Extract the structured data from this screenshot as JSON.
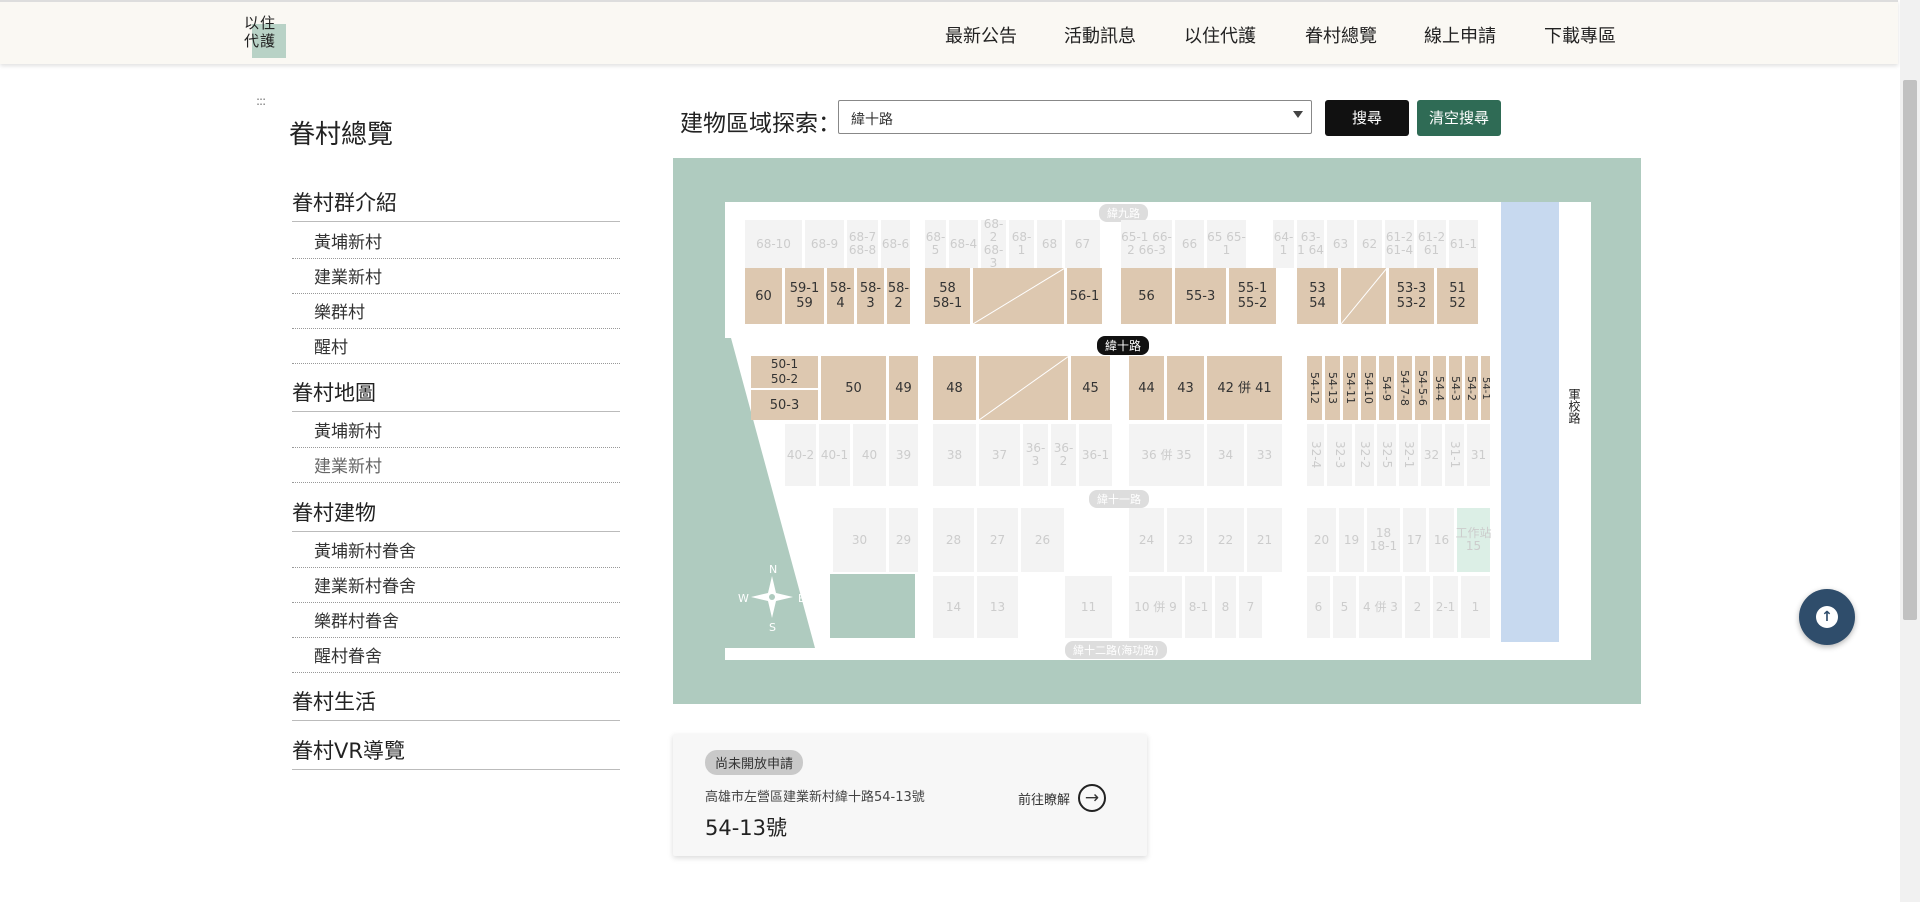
{
  "header": {
    "logo_line1": "以住",
    "logo_line2": "代護",
    "nav": [
      "最新公告",
      "活動訊息",
      "以住代護",
      "眷村總覽",
      "線上申請",
      "下載專區"
    ]
  },
  "sidebar": {
    "handle": ":::",
    "title": "眷村總覽",
    "sections": [
      {
        "label": "眷村群介紹",
        "items": [
          "黃埔新村",
          "建業新村",
          "樂群村",
          "醒村"
        ]
      },
      {
        "label": "眷村地圖",
        "items": [
          "黃埔新村",
          "建業新村"
        ]
      },
      {
        "label": "眷村建物",
        "items": [
          "黃埔新村眷舍",
          "建業新村眷舍",
          "樂群村眷舍",
          "醒村眷舍"
        ]
      },
      {
        "label": "眷村生活",
        "items": []
      },
      {
        "label": "眷村VR導覽",
        "items": []
      }
    ]
  },
  "search": {
    "label": "建物區域探索：",
    "selected": "緯十路",
    "search_button": "搜尋",
    "clear_button": "清空搜尋"
  },
  "map": {
    "roads": {
      "north": "緯九路",
      "middle": "緯十路",
      "south_mid": "緯十一路",
      "south": "緯十二路(海功路)",
      "east": "軍校路"
    },
    "compass": {
      "n": "N",
      "s": "S",
      "e": "E",
      "w": "W"
    },
    "active_row1": [
      "60",
      "59-1\n59",
      "58-4",
      "58-3",
      "58-2",
      "58\n58-1",
      "56-1",
      "56",
      "55-3",
      "55-1\n55-2",
      "53\n54",
      "53-3\n53-2",
      "51\n52"
    ],
    "active_row2": [
      "50-1\n50-2",
      "50-3",
      "50",
      "49",
      "48",
      "45",
      "44",
      "43",
      "42 併 41",
      "54-12",
      "54-13",
      "54-11",
      "54-10",
      "54-9",
      "54-7-8",
      "54-5-6",
      "54-4",
      "54-3",
      "54-2",
      "54-1"
    ],
    "ghost_top": [
      "68-10",
      "68-9",
      "68-7\n68-8",
      "68-6",
      "68-5",
      "68-4",
      "68-2\n68-3",
      "68-1",
      "68",
      "67",
      "65-1\n66-2\n66-3",
      "66",
      "65\n65-1",
      "64-1",
      "63-1\n64",
      "63",
      "62",
      "61-2\n61-4",
      "61-2\n61",
      "61-1"
    ],
    "ghost_mid": [
      "40-2",
      "40-1",
      "40",
      "39",
      "38",
      "37",
      "36-3",
      "36-2",
      "36-1",
      "36 併 35",
      "34",
      "33",
      "32-4",
      "32-3",
      "32-2",
      "32-5",
      "32-1",
      "32",
      "31-1",
      "31"
    ],
    "ghost_low": [
      "30",
      "29",
      "28",
      "27",
      "26",
      "24",
      "23",
      "22",
      "21",
      "20",
      "19",
      "18\n18-1",
      "17",
      "16",
      "工作站\n15"
    ],
    "ghost_bottom": [
      "14",
      "13",
      "11",
      "10 併 9",
      "8-1",
      "8",
      "7",
      "6",
      "5",
      "4 併 3",
      "2",
      "2-1",
      "1"
    ]
  },
  "info_card": {
    "badge": "尚未開放申請",
    "address": "高雄市左營區建業新村緯十路54-13號",
    "number": "54-13號",
    "link": "前往瞭解"
  },
  "colors": {
    "map_bg": "#afcbbf",
    "lot_active": "#ddc8b0",
    "road_blue": "#c7d9ef",
    "btn_clear": "#2f6b55",
    "fab": "#2f4d6b"
  }
}
